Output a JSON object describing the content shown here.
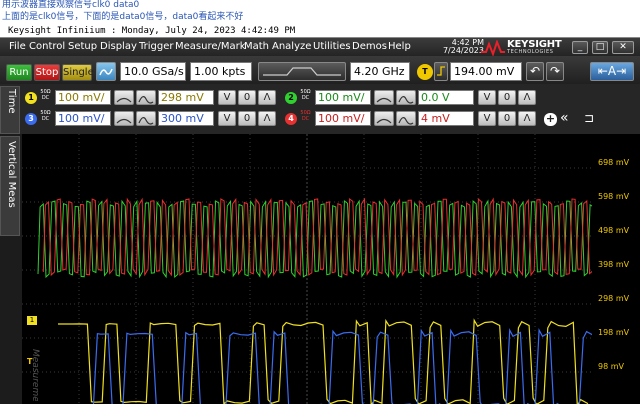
{
  "annotation": {
    "line1": "用示波器直接观察信号clk0 data0",
    "line2": "上面的是clk0信号，下面的是data0信号，data0看起来不好"
  },
  "window": {
    "title": "Keysight Infiniium : Monday, July 24, 2023 4:42:49 PM"
  },
  "menu": [
    "File",
    "Control",
    "Setup",
    "Display",
    "Trigger",
    "Measure/Mark",
    "Math",
    "Analyze",
    "Utilities",
    "Demos",
    "Help"
  ],
  "clock": {
    "time": "4:42 PM",
    "date": "7/24/2023"
  },
  "logo": {
    "name": "KEYSIGHT",
    "sub": "TECHNOLOGIES"
  },
  "toolbar": {
    "run": "Run",
    "stop": "Stop",
    "single": "Single",
    "sample_rate": "10.0 GSa/s",
    "points": "1.00 kpts",
    "bandwidth": "4.20 GHz",
    "trigger_badge": "T",
    "trigger_level": "194.00 mV"
  },
  "sidetabs": {
    "time_meas": "Time Meas",
    "vertical_meas": "Vertical Meas"
  },
  "channels": [
    {
      "num": "1",
      "ohm": "50Ω",
      "coupling": "DC",
      "scale": "100 mV/",
      "offset": "298 mV",
      "color": "#f0e020"
    },
    {
      "num": "2",
      "ohm": "50Ω",
      "coupling": "DC",
      "scale": "100 mV/",
      "offset": "0.0 V",
      "color": "#30d030"
    },
    {
      "num": "3",
      "ohm": "50Ω",
      "coupling": "DC",
      "scale": "100 mV/",
      "offset": "300 mV",
      "color": "#3a6cf0"
    },
    {
      "num": "4",
      "ohm": "50Ω",
      "coupling": "DC",
      "scale": "100 mV/",
      "offset": "4 mV",
      "color": "#e83030"
    }
  ],
  "controls": {
    "zero": "0",
    "down": "V",
    "plus": "+",
    "collapse": "«",
    "pin": "⊐"
  },
  "markers": {
    "trigger": "T",
    "channel": "1"
  },
  "watermark": "Measurements",
  "right_scale": [
    "698 mV",
    "598 mV",
    "498 mV",
    "398 mV",
    "298 mV",
    "198 mV",
    "98 mV"
  ],
  "colors": {
    "ch1": "#f0e020",
    "ch2": "#30d030",
    "ch3": "#3a6cf0",
    "ch4": "#e83030",
    "run": "#2ea42e",
    "stop": "#d02020",
    "single": "#c8b020"
  },
  "waveforms": {
    "clk_description_hidden": false,
    "clock_cycles": 47,
    "data_bits": [
      1,
      1,
      0,
      1,
      0,
      0,
      1,
      1,
      0,
      1,
      1,
      0,
      0,
      1,
      0,
      1,
      1,
      1,
      0,
      0,
      1,
      0,
      1,
      1,
      0,
      1,
      0,
      0,
      1,
      1,
      0,
      1,
      0,
      1,
      1,
      0
    ]
  }
}
